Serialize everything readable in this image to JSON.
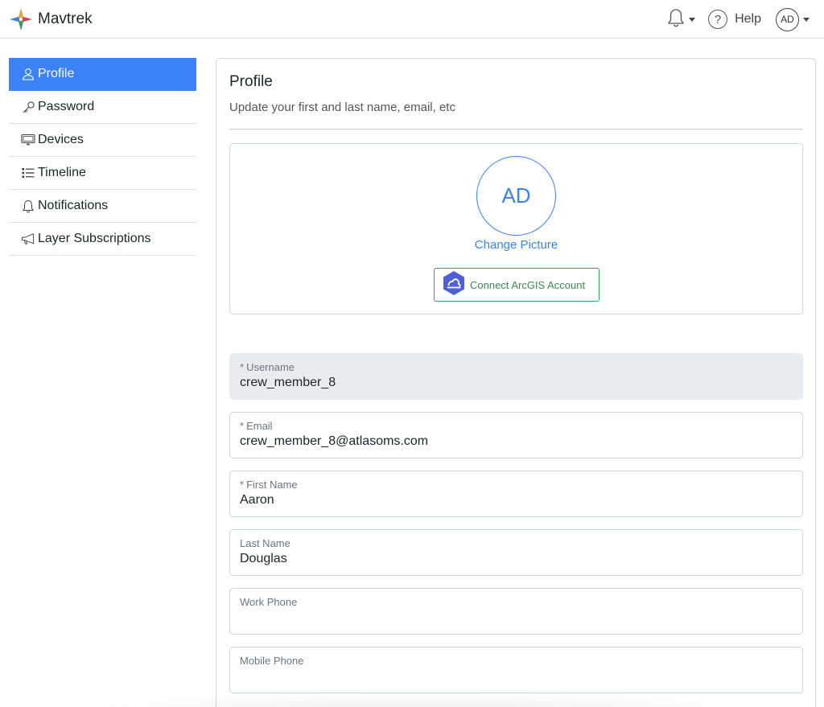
{
  "app": {
    "name": "Mavtrek"
  },
  "topbar": {
    "help_label": "Help",
    "avatar_initials": "AD"
  },
  "sidebar": {
    "items": [
      {
        "label": "Profile",
        "icon": "person-icon",
        "active": true
      },
      {
        "label": "Password",
        "icon": "key-icon",
        "active": false
      },
      {
        "label": "Devices",
        "icon": "monitor-icon",
        "active": false
      },
      {
        "label": "Timeline",
        "icon": "list-icon",
        "active": false
      },
      {
        "label": "Notifications",
        "icon": "bell-icon",
        "active": false
      },
      {
        "label": "Layer Subscriptions",
        "icon": "megaphone-icon",
        "active": false
      }
    ]
  },
  "profile": {
    "title": "Profile",
    "subtitle": "Update your first and last name, email, etc",
    "avatar_initials": "AD",
    "change_picture_label": "Change Picture",
    "arcgis_button_label": "Connect ArcGIS Account"
  },
  "form": {
    "required_mark": "*",
    "fields": [
      {
        "label": "Username",
        "value": "crew_member_8",
        "required": true,
        "disabled": true
      },
      {
        "label": "Email",
        "value": "crew_member_8@atlasoms.com",
        "required": true,
        "disabled": false
      },
      {
        "label": "First Name",
        "value": "Aaron",
        "required": true,
        "disabled": false
      },
      {
        "label": "Last Name",
        "value": "Douglas",
        "required": false,
        "disabled": false
      },
      {
        "label": "Work Phone",
        "value": "",
        "required": false,
        "disabled": false
      },
      {
        "label": "Mobile Phone",
        "value": "",
        "required": false,
        "disabled": false
      }
    ]
  },
  "colors": {
    "accent": "#3b82f6",
    "arcgis_border": "#3ca35c",
    "arcgis_icon": "#4f5fd6"
  }
}
